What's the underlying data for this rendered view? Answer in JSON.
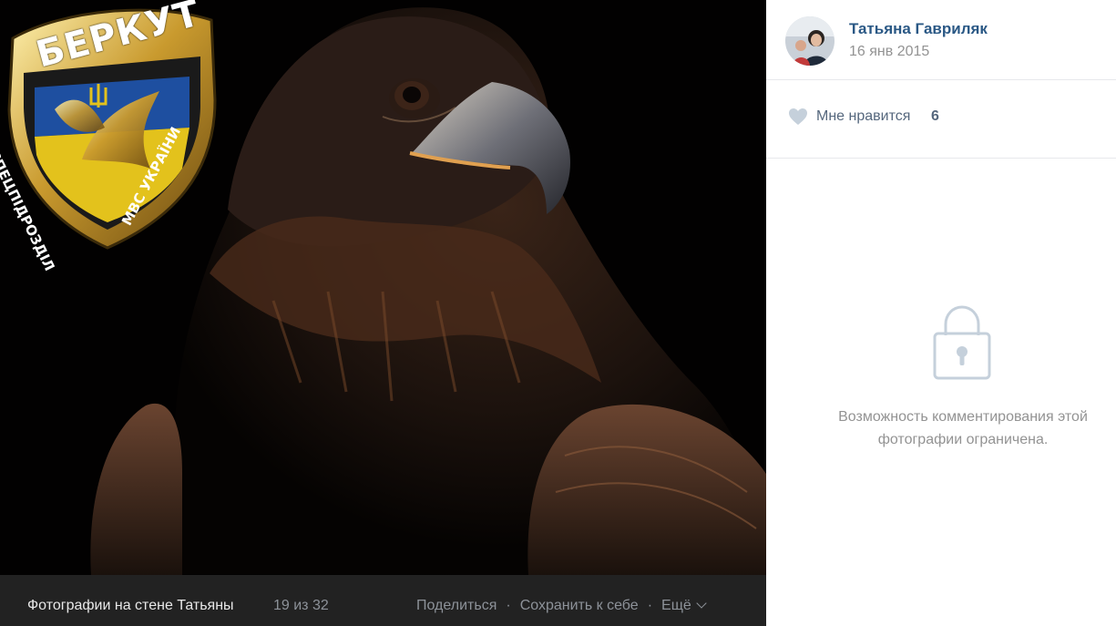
{
  "photo": {
    "badge_title": "БЕРКУТ",
    "badge_sub_left": "СПЕЦПІДРОЗДІЛ",
    "badge_sub_right": "МВС УКРАЇНИ",
    "badge_icon": "trident-icon",
    "subject_icon": "eagle-icon"
  },
  "footer": {
    "album_title": "Фотографии на стене Татьяны",
    "counter": "19 из 32",
    "share_label": "Поделиться",
    "separator": "·",
    "save_label": "Сохранить к себе",
    "more_label": "Ещё"
  },
  "author": {
    "name": "Татьяна Гавриляк",
    "date": "16 янв 2015"
  },
  "likes": {
    "label": "Мне нравится",
    "count": "6",
    "icon": "heart-icon"
  },
  "comments": {
    "icon": "lock-icon",
    "restricted_line1": "Возможность комментирования этой",
    "restricted_line2": "фотографии ограничена."
  },
  "colors": {
    "viewer_bg": "#000000",
    "footer_bg": "#222222",
    "link_blue": "#2a5885",
    "muted_gray": "#939393",
    "icon_gray": "#c5d0db"
  }
}
